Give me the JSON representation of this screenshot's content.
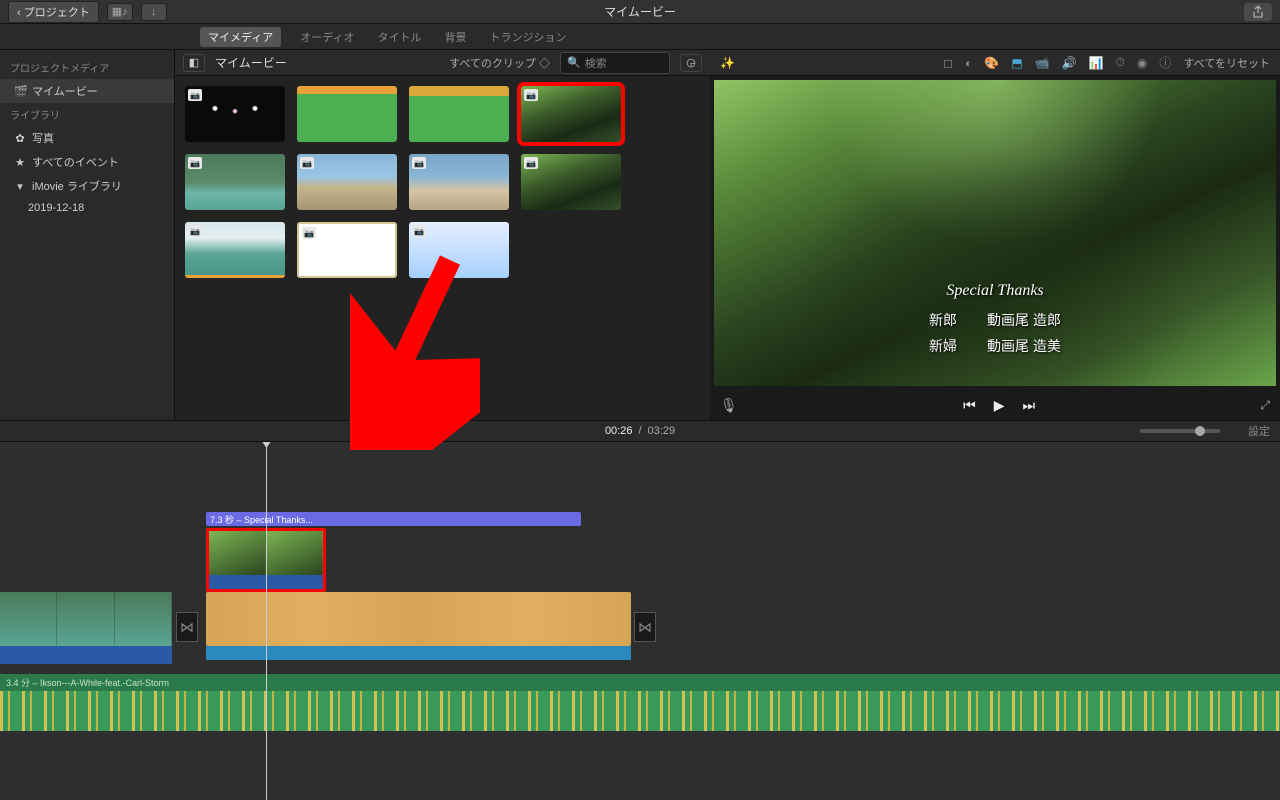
{
  "titlebar": {
    "back": "プロジェクト",
    "title": "マイムービー"
  },
  "tabs": {
    "my_media": "マイメディア",
    "audio": "オーディオ",
    "titles": "タイトル",
    "backgrounds": "背景",
    "transitions": "トランジション"
  },
  "sidebar": {
    "hdr1": "プロジェクトメディア",
    "my_movie": "マイムービー",
    "hdr2": "ライブラリ",
    "photos": "写真",
    "all_events": "すべてのイベント",
    "lib": "iMovie ライブラリ",
    "date": "2019-12-18"
  },
  "browser": {
    "crumb": "マイムービー",
    "filter": "すべてのクリップ",
    "search": "検索"
  },
  "preview": {
    "reset": "すべてをリセット",
    "special": "Special Thanks",
    "row1_l": "新郎",
    "row1_r": "動画尾 造郎",
    "row2_l": "新婦",
    "row2_r": "動画尾 造美"
  },
  "timeline": {
    "cur": "00:26",
    "dur": "03:29",
    "settings": "設定",
    "title_clip": "7.3 秒 – Special Thanks...",
    "audio_clip": "3.4 分 – Ikson---A-While-feat.-Carl-Storm"
  }
}
